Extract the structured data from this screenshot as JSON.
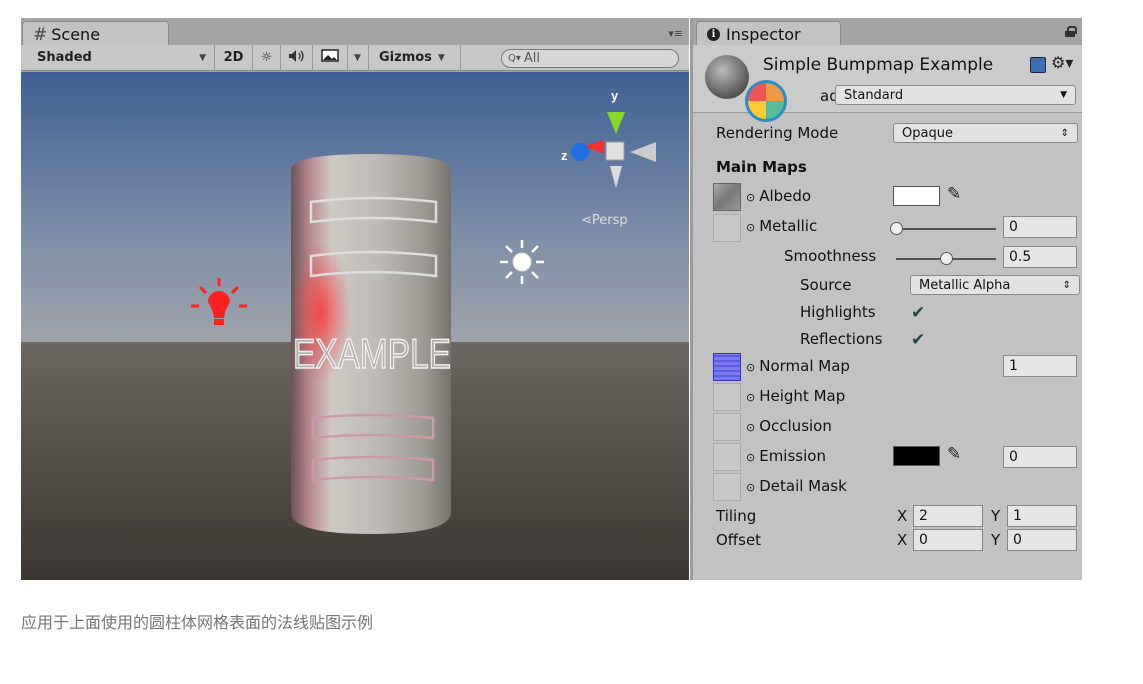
{
  "scene": {
    "tab_label": "Scene",
    "tab_menu": "▾≡",
    "toolbar": {
      "shaded": "Shaded",
      "mode_2d": "2D",
      "gizmos": "Gizmos",
      "search_placeholder": "All"
    },
    "persp_label": "⋖Persp",
    "axis_y": "y",
    "axis_z": "z",
    "cylinder_text": "EXAMPLE"
  },
  "inspector": {
    "tab_label": "Inspector",
    "material_name": "Simple Bumpmap Example",
    "shader_label": "Shader",
    "shader_value": "Standard",
    "rendering_mode_label": "Rendering Mode",
    "rendering_mode_value": "Opaque",
    "main_maps_label": "Main Maps",
    "albedo_label": "Albedo",
    "metallic_label": "Metallic",
    "metallic_value": "0",
    "metallic_level": 0.0,
    "smoothness_label": "Smoothness",
    "smoothness_value": "0.5",
    "smoothness_level": 0.5,
    "source_label": "Source",
    "source_value": "Metallic Alpha",
    "highlights_label": "Highlights",
    "highlights_checked": true,
    "reflections_label": "Reflections",
    "reflections_checked": true,
    "normal_map_label": "Normal Map",
    "normal_map_value": "1",
    "height_map_label": "Height Map",
    "occlusion_label": "Occlusion",
    "emission_label": "Emission",
    "emission_value": "0",
    "emission_color": "#000000",
    "albedo_color": "#ffffff",
    "detail_mask_label": "Detail Mask",
    "tiling_label": "Tiling",
    "tiling_x": "2",
    "tiling_y": "1",
    "offset_label": "Offset",
    "offset_x": "0",
    "offset_y": "0",
    "x_label": "X",
    "y_label": "Y"
  },
  "caption": "应用于上面使用的圆柱体网格表面的法线贴图示例"
}
